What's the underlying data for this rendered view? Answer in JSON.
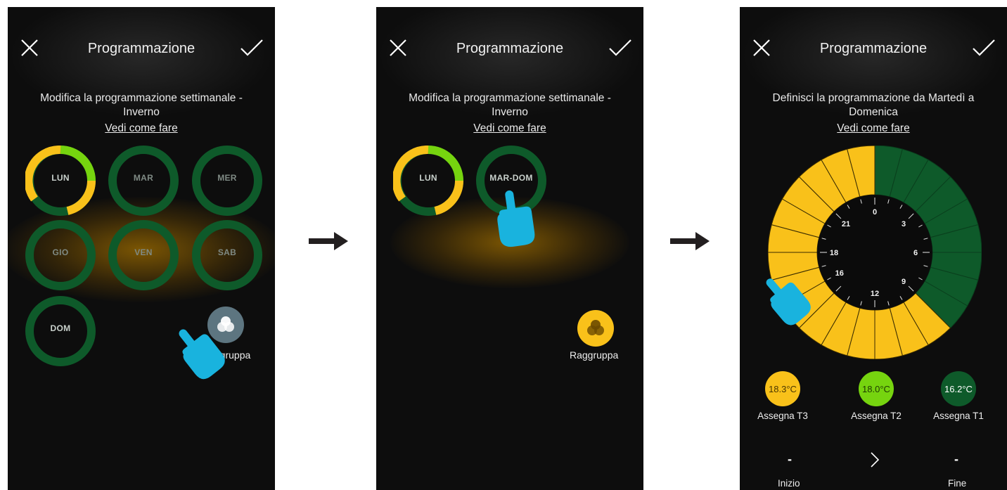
{
  "screens": [
    {
      "title": "Programmazione",
      "subtitle_line1": "Modifica la programmazione settimanale -",
      "subtitle_line2": "Inverno",
      "howto": "Vedi come fare",
      "days": [
        "LUN",
        "MAR",
        "MER",
        "GIO",
        "VEN",
        "SAB",
        "DOM"
      ],
      "group_label": "Raggruppa"
    },
    {
      "title": "Programmazione",
      "subtitle_line1": "Modifica la programmazione settimanale -",
      "subtitle_line2": "Inverno",
      "howto": "Vedi come fare",
      "days": [
        "LUN",
        "MAR-DOM"
      ],
      "group_label": "Raggruppa"
    },
    {
      "title": "Programmazione",
      "subtitle_line1": "Definisci la programmazione da Martedì a",
      "subtitle_line2": "Domenica",
      "howto": "Vedi come fare",
      "dial_hours": [
        "0",
        "3",
        "6",
        "9",
        "12",
        "16",
        "18",
        "21"
      ],
      "temps": [
        {
          "value": "18.3°C",
          "label": "Assegna T3",
          "color": "#f9c11a"
        },
        {
          "value": "18.0°C",
          "label": "Assegna T2",
          "color": "#76d40f"
        },
        {
          "value": "16.2°C",
          "label": "Assegna T1",
          "color": "#0e5a2a"
        }
      ],
      "start_value": "-",
      "start_label": "Inizio",
      "end_value": "-",
      "end_label": "Fine"
    }
  ],
  "colors": {
    "ring_green": "#0e5a2a",
    "lun_yellow": "#f9c11a",
    "lun_lime": "#76d40f",
    "pointer_hand": "#19b3de",
    "group_btn_inactive": "#5d7580",
    "group_btn_active": "#f9c11a",
    "arrow": "#231f20"
  },
  "icons": [
    "close-icon",
    "check-icon",
    "group-icon",
    "pointing-hand-icon",
    "right-arrow-icon",
    "chevron-right-icon"
  ]
}
